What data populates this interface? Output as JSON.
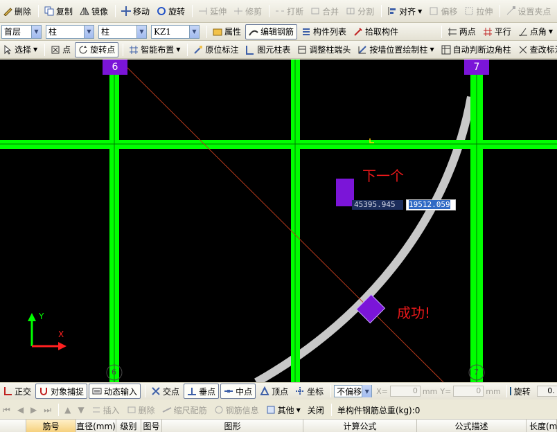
{
  "toolbar1": {
    "delete": "删除",
    "copy": "复制",
    "mirror": "镜像",
    "move": "移动",
    "rotate": "旋转",
    "extend": "延伸",
    "trim": "修剪",
    "break": "打断",
    "merge": "合并",
    "split": "分割",
    "align": "对齐",
    "offset": "偏移",
    "stretch": "拉伸",
    "set_grip": "设置夹点"
  },
  "toolbar2": {
    "floor": "首层",
    "category": "柱",
    "type": "柱",
    "component": "KZ1",
    "properties": "属性",
    "edit_rebar": "编辑钢筋",
    "component_list": "构件列表",
    "pick_component": "拾取构件",
    "two_points": "两点",
    "parallel": "平行",
    "point_angle": "点角"
  },
  "toolbar3": {
    "select": "选择",
    "point": "点",
    "rotate_point": "旋转点",
    "smart_layout": "智能布置",
    "in_place_label": "原位标注",
    "column_table": "图元柱表",
    "adjust_column_end": "调整柱端头",
    "draw_by_wall": "按墙位置绘制柱",
    "auto_corner": "自动判断边角柱",
    "modify_label": "查改标注"
  },
  "canvas": {
    "axis_6": "6",
    "axis_7": "7",
    "coord_x": "45395.945",
    "coord_y": "19512.059",
    "msg_next": "下一个",
    "msg_success": "成功!",
    "ucs_x": "X",
    "ucs_y": "Y",
    "colors": {
      "grid": "#00ff00",
      "axis_label": "#7b15d8",
      "arc": "#c8c8c8",
      "column": "#7b15d8",
      "message": "#e8181a"
    }
  },
  "status": {
    "ortho": "正交",
    "snap": "对象捕捉",
    "dynamic_input": "动态输入",
    "intersection": "交点",
    "perpendicular": "垂点",
    "midpoint": "中点",
    "vertex": "顶点",
    "coordinate": "坐标",
    "offset_mode": "不偏移",
    "x_label": "X=",
    "x_value": "0",
    "x_unit": "mm",
    "y_label": "Y=",
    "y_value": "0",
    "y_unit": "mm",
    "rotate": "旋转",
    "rotate_value": "0."
  },
  "rebar_panel": {
    "insert": "插入",
    "delete": "删除",
    "ruler_rebar": "缩尺配筋",
    "rebar_info": "钢筋信息",
    "other": "其他",
    "close": "关闭",
    "total_weight_label": "单构件钢筋总重(kg):0"
  },
  "table_headers": [
    "筋号",
    "直径(mm)",
    "级别",
    "图号",
    "图形",
    "计算公式",
    "公式描述",
    "长度(mm)"
  ]
}
